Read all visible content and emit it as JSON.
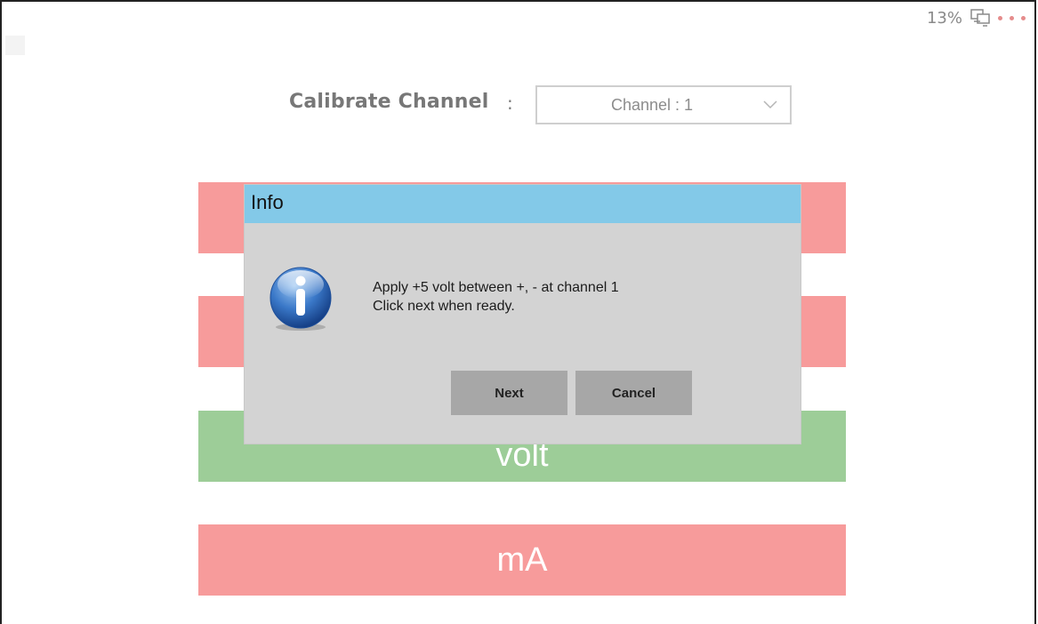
{
  "status": {
    "battery_percent": "13%",
    "network_icon": "network-computer-icon",
    "menu_icon": "more-dots-icon"
  },
  "calibrate": {
    "label": "Calibrate Channel",
    "separator": ":",
    "channel_value": "Channel : 1"
  },
  "bars": [
    {
      "label": "",
      "color": "#f79b9b"
    },
    {
      "label": "",
      "color": "#f79b9b"
    },
    {
      "label": "volt",
      "color": "#9dcd98"
    },
    {
      "label": "mA",
      "color": "#f79b9b"
    }
  ],
  "dialog": {
    "title": "Info",
    "icon": "info-icon",
    "message_line1": "Apply +5 volt between +, - at channel 1",
    "message_line2": "Click next when ready.",
    "next_label": "Next",
    "cancel_label": "Cancel"
  }
}
